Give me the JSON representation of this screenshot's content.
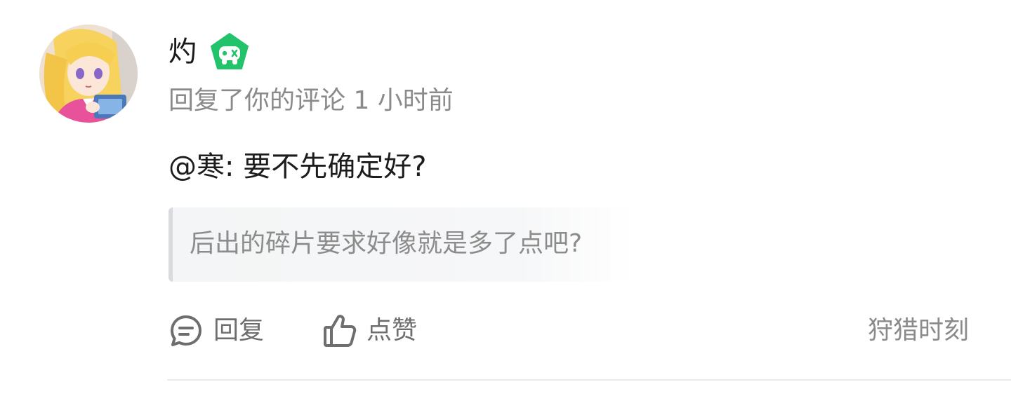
{
  "user": {
    "name": "灼",
    "avatar_icon": "anime-avatar",
    "badge_icon": "gamepad-badge-icon",
    "badge_color": "#22c36a"
  },
  "meta": {
    "text": "回复了你的评论 1 小时前"
  },
  "reply": {
    "text": "@寒: 要不先确定好?"
  },
  "quote": {
    "text": "后出的碎片要求好像就是多了点吧?"
  },
  "actions": {
    "reply_label": "回复",
    "reply_icon": "comment-icon",
    "like_label": "点赞",
    "like_icon": "thumbs-up-icon"
  },
  "source": {
    "label": "狩猎时刻"
  },
  "colors": {
    "primary_text": "#1a1a1a",
    "secondary_text": "#8a8a8a",
    "quote_bg": "#f5f6f7",
    "quote_bar": "#d8dadd"
  }
}
